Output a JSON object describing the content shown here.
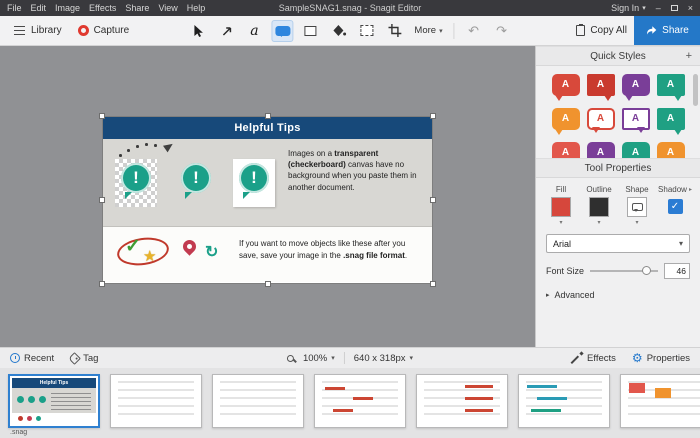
{
  "window": {
    "title": "SampleSNAG1.snag - Snagit Editor",
    "sign_in": "Sign In"
  },
  "menubar": {
    "items": [
      "File",
      "Edit",
      "Image",
      "Effects",
      "Share",
      "View",
      "Help"
    ]
  },
  "toolbar": {
    "library": "Library",
    "capture": "Capture",
    "text_tool": "a",
    "more": "More",
    "copy_all": "Copy All",
    "share": "Share"
  },
  "canvas": {
    "card": {
      "title": "Helpful Tips",
      "body": {
        "t1": "Images on a ",
        "t2": "transparent (checkerboard)",
        "t3": " canvas have no background when you paste them in another document."
      },
      "footer": {
        "t1": "If you want to move objects like these after you save, save your image in the ",
        "t2": ".snag file format",
        "t3": "."
      }
    }
  },
  "sidebar": {
    "quick_styles": {
      "title": "Quick Styles",
      "letter": "A",
      "items": [
        {
          "color": "#d8493b"
        },
        {
          "color": "#c93a2e"
        },
        {
          "color": "#7a3e98"
        },
        {
          "color": "#1fa083"
        },
        {
          "color": "#f0932e"
        },
        {
          "color": "#d8493b"
        },
        {
          "color": "#7a3e98"
        },
        {
          "color": "#1fa083"
        },
        {
          "color": "#e2574c"
        },
        {
          "color": "#7a3e98"
        },
        {
          "color": "#1fa083"
        },
        {
          "color": "#f0932e"
        }
      ]
    },
    "tool_properties": {
      "title": "Tool Properties",
      "fill_label": "Fill",
      "outline_label": "Outline",
      "shape_label": "Shape",
      "shadow_label": "Shadow",
      "fill_color": "#d6473c",
      "outline_color": "#2f2f2f",
      "font": "Arial",
      "font_size_label": "Font Size",
      "font_size": "46",
      "advanced": "Advanced"
    }
  },
  "statusbar": {
    "recent": "Recent",
    "tag": "Tag",
    "zoom": "100%",
    "dimensions": "640 x 318px",
    "effects": "Effects",
    "properties": "Properties"
  },
  "filmstrip": {
    "extension": ".snag"
  },
  "colors": {
    "accent_blue": "#2478c8",
    "title_navy": "#17497a",
    "teal": "#1ba089",
    "capture_red": "#e0392f"
  },
  "icons": {
    "caret_down": "▾",
    "caret_right": "▸",
    "minimize": "–",
    "close": "×",
    "undo": "↶",
    "redo": "↷",
    "check": "✓",
    "star": "★",
    "rotate_arrow": "↻",
    "gear": "⚙",
    "plus": "+",
    "exclamation": "!"
  }
}
